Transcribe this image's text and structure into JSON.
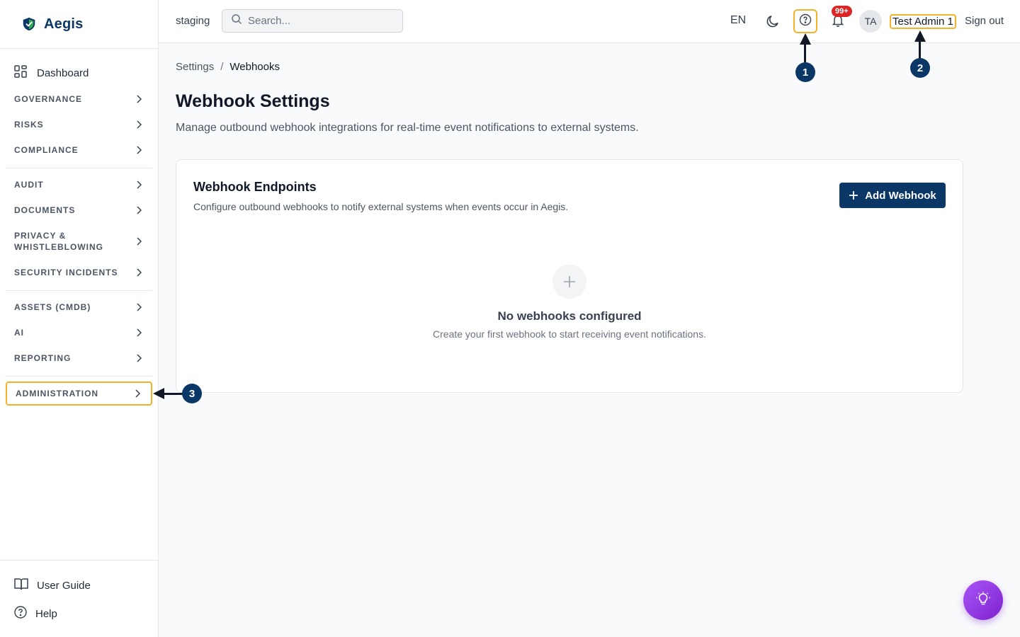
{
  "app": {
    "name": "Aegis"
  },
  "sidebar": {
    "dashboard_label": "Dashboard",
    "groups": [
      {
        "label": "GOVERNANCE"
      },
      {
        "label": "RISKS"
      },
      {
        "label": "COMPLIANCE"
      },
      {
        "label": "AUDIT"
      },
      {
        "label": "DOCUMENTS"
      },
      {
        "label": "PRIVACY &\nWHISTLEBLOWING"
      },
      {
        "label": "SECURITY INCIDENTS"
      },
      {
        "label": "ASSETS (CMDB)"
      },
      {
        "label": "AI"
      },
      {
        "label": "REPORTING"
      },
      {
        "label": "ADMINISTRATION"
      }
    ],
    "bottom": {
      "user_guide": "User Guide",
      "help": "Help"
    }
  },
  "topbar": {
    "environment": "staging",
    "search_placeholder": "Search...",
    "language": "EN",
    "notifications_badge": "99+",
    "avatar_initials": "TA",
    "user_name": "Test Admin 1",
    "sign_out": "Sign out"
  },
  "breadcrumb": {
    "parent": "Settings",
    "separator": "/",
    "current": "Webhooks"
  },
  "page": {
    "title": "Webhook Settings",
    "subtitle": "Manage outbound webhook integrations for real-time event notifications to external systems."
  },
  "card": {
    "title": "Webhook Endpoints",
    "subtitle": "Configure outbound webhooks to notify external systems when events occur in Aegis.",
    "add_button": "Add Webhook",
    "empty_title": "No webhooks configured",
    "empty_subtitle": "Create your first webhook to start receiving event notifications."
  },
  "annotations": {
    "one": "1",
    "two": "2",
    "three": "3"
  },
  "colors": {
    "brand": "#0b3766",
    "highlight": "#f5b128",
    "badge": "#dc2626",
    "fab": "#9333ea"
  }
}
